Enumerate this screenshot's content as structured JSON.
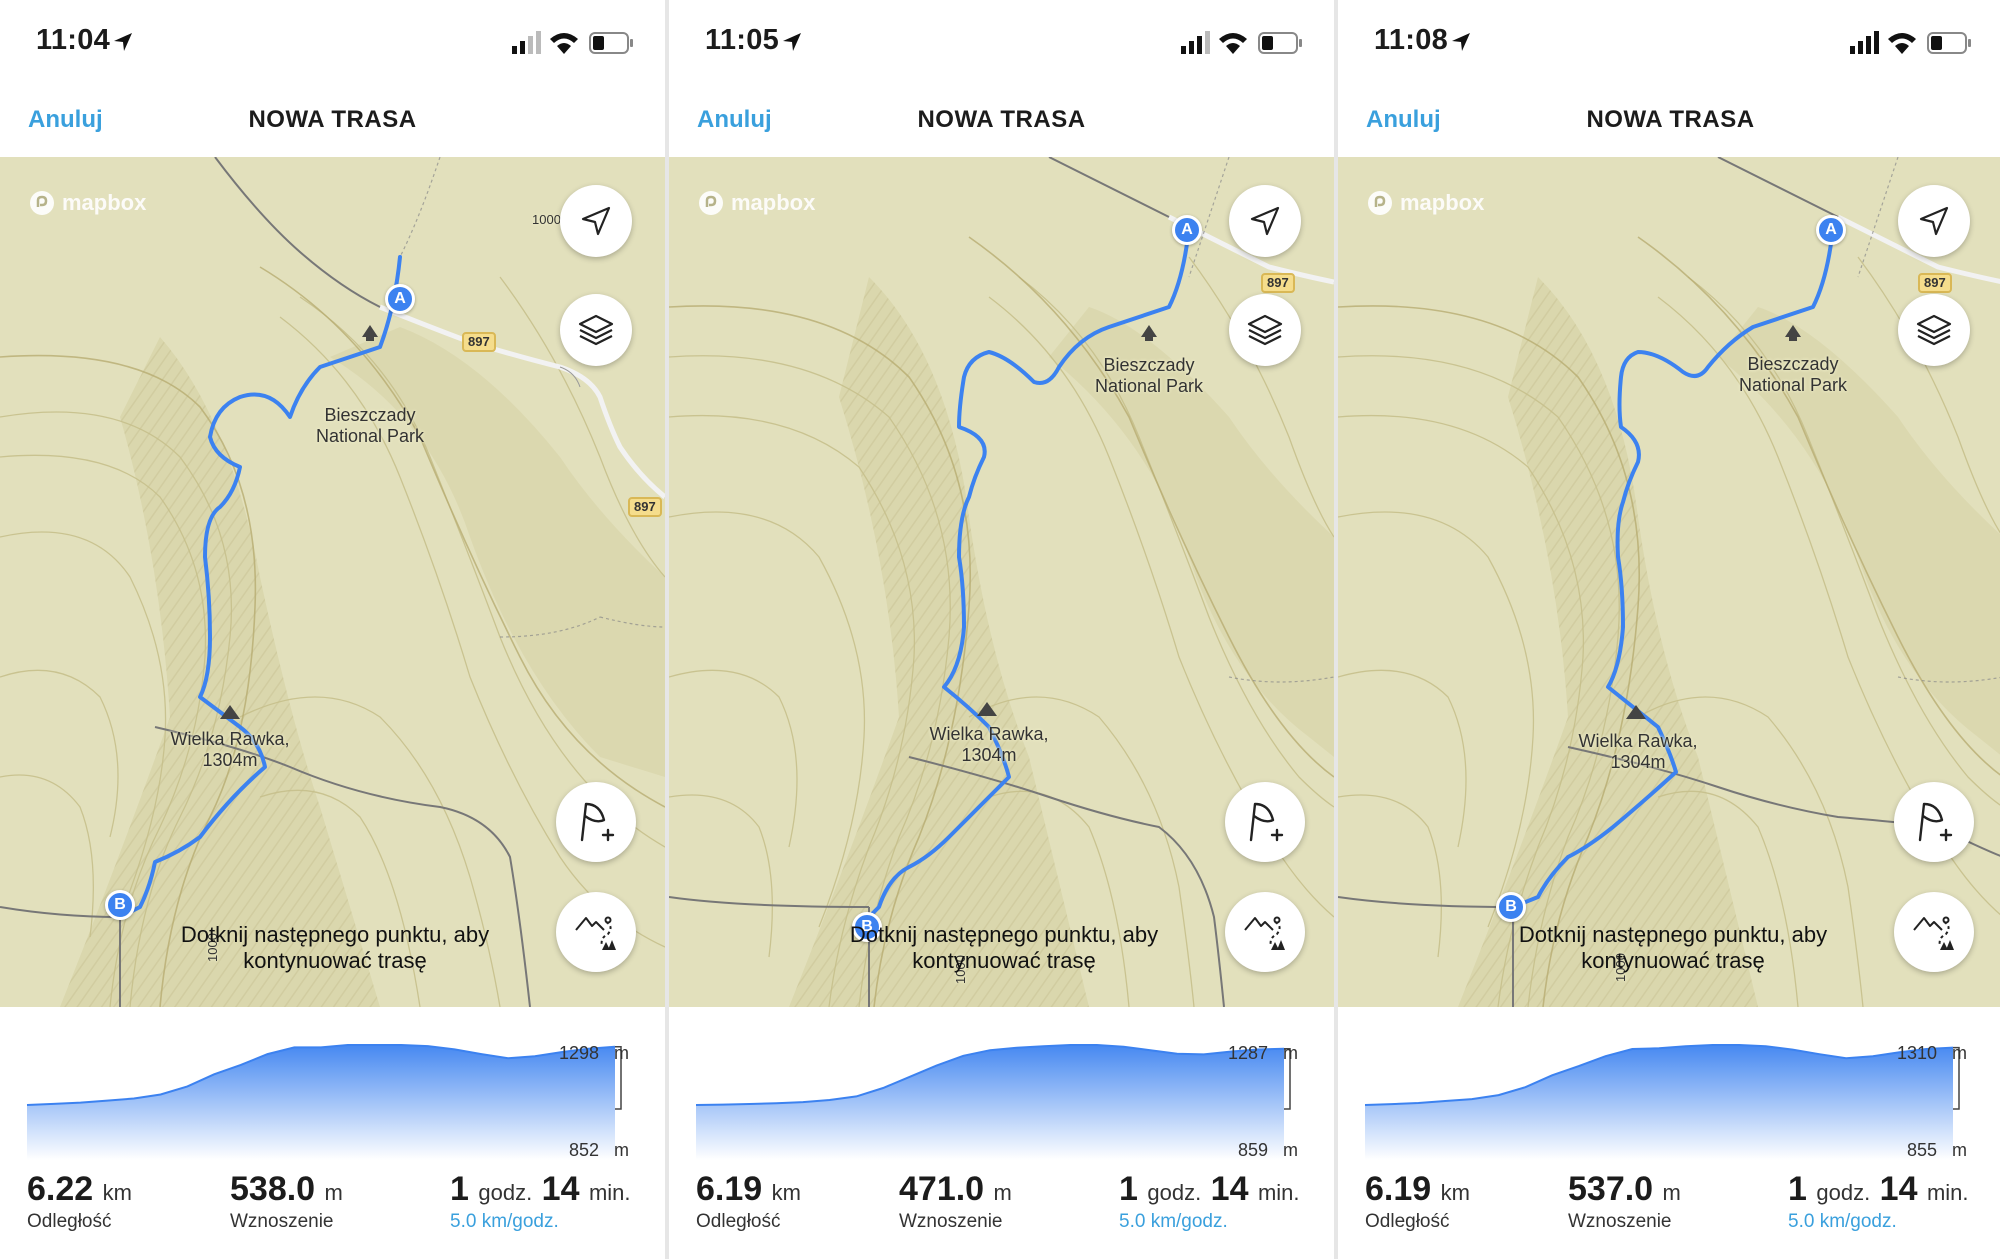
{
  "screens": [
    {
      "time": "11:04",
      "nav": {
        "cancel_label": "Anuluj",
        "title": "NOWA TRASA"
      },
      "map": {
        "attribution": "mapbox",
        "park_label": [
          "Bieszczady",
          "National Park"
        ],
        "peak_label": [
          "Wielka Rawka,",
          "1304m"
        ],
        "road_badge": "897",
        "road_badge_2": "897",
        "contour_label_1": "1000",
        "contour_label_2": "1000",
        "start_marker": "A",
        "end_marker": "B",
        "tip": [
          "Dotknij następnego punktu, aby",
          "kontynuować trasę"
        ]
      },
      "elevation": {
        "max": "1298",
        "min": "852",
        "unit": "m",
        "profile": [
          852,
          860,
          870,
          885,
          900,
          930,
          990,
          1080,
          1150,
          1230,
          1280,
          1280,
          1298,
          1298,
          1298,
          1290,
          1265,
          1230,
          1200,
          1215,
          1245,
          1270,
          1285
        ]
      },
      "stats": {
        "distance": {
          "value": "6.22",
          "unit": "km",
          "label": "Odległość"
        },
        "ascent": {
          "value": "538.0",
          "unit": "m",
          "label": "Wznoszenie"
        },
        "duration": {
          "hours": "1",
          "hours_unit": "godz.",
          "minutes": "14",
          "minutes_unit": "min.",
          "speed": "5.0 km/godz."
        }
      }
    },
    {
      "time": "11:05",
      "nav": {
        "cancel_label": "Anuluj",
        "title": "NOWA TRASA"
      },
      "map": {
        "attribution": "mapbox",
        "park_label": [
          "Bieszczady",
          "National Park"
        ],
        "peak_label": [
          "Wielka Rawka,",
          "1304m"
        ],
        "road_badge": "897",
        "contour_label_1": "1000",
        "start_marker": "A",
        "end_marker": "B",
        "tip": [
          "Dotknij następnego punktu, aby",
          "kontynuować trasę"
        ]
      },
      "elevation": {
        "max": "1287",
        "min": "859",
        "unit": "m",
        "profile": [
          859,
          862,
          866,
          872,
          880,
          895,
          920,
          980,
          1060,
          1140,
          1210,
          1250,
          1268,
          1278,
          1287,
          1287,
          1275,
          1250,
          1225,
          1220,
          1240,
          1255,
          1260
        ]
      },
      "stats": {
        "distance": {
          "value": "6.19",
          "unit": "km",
          "label": "Odległość"
        },
        "ascent": {
          "value": "471.0",
          "unit": "m",
          "label": "Wznoszenie"
        },
        "duration": {
          "hours": "1",
          "hours_unit": "godz.",
          "minutes": "14",
          "minutes_unit": "min.",
          "speed": "5.0 km/godz."
        }
      }
    },
    {
      "time": "11:08",
      "nav": {
        "cancel_label": "Anuluj",
        "title": "NOWA TRASA"
      },
      "map": {
        "attribution": "mapbox",
        "park_label": [
          "Bieszczady",
          "National Park"
        ],
        "peak_label": [
          "Wielka Rawka,",
          "1304m"
        ],
        "road_badge": "897",
        "contour_label_1": "1000",
        "start_marker": "A",
        "end_marker": "B",
        "tip": [
          "Dotknij następnego punktu, aby",
          "kontynuować trasę"
        ]
      },
      "elevation": {
        "max": "1310",
        "min": "855",
        "unit": "m",
        "profile": [
          855,
          862,
          870,
          885,
          900,
          930,
          990,
          1080,
          1150,
          1225,
          1280,
          1285,
          1300,
          1310,
          1310,
          1300,
          1275,
          1240,
          1210,
          1225,
          1255,
          1280,
          1290
        ]
      },
      "stats": {
        "distance": {
          "value": "6.19",
          "unit": "km",
          "label": "Odległość"
        },
        "ascent": {
          "value": "537.0",
          "unit": "m",
          "label": "Wznoszenie"
        },
        "duration": {
          "hours": "1",
          "hours_unit": "godz.",
          "minutes": "14",
          "minutes_unit": "min.",
          "speed": "5.0 km/godz."
        }
      }
    }
  ],
  "colors": {
    "route": "#3c82f0",
    "accent": "#3aa0dd",
    "map_base": "#dfddb6"
  }
}
